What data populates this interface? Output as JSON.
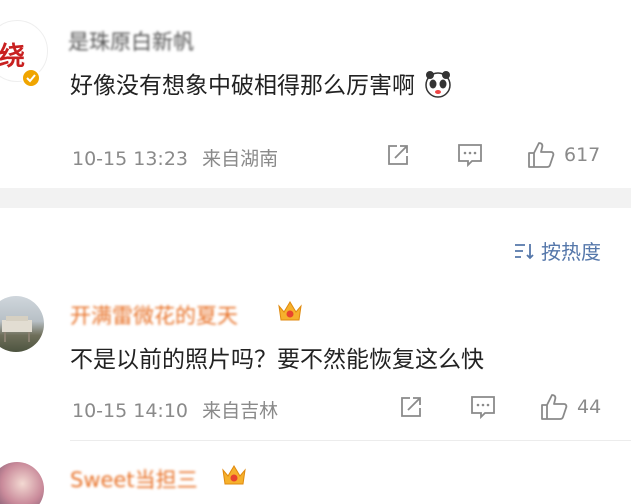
{
  "comments": [
    {
      "username": "是珠原白新帆",
      "avatar_text": "绕",
      "text": "好像没有想象中破相得那么厉害啊",
      "date": "10-15 13:23",
      "location": "来自湖南",
      "likes": "617"
    },
    {
      "username": "开满雷微花的夏天",
      "text": "不是以前的照片吗？要不然能恢复这么快",
      "date": "10-15 14:10",
      "location": "来自吉林",
      "likes": "44"
    },
    {
      "username": "Sweet当担三"
    }
  ],
  "sort_label": "按热度",
  "colors": {
    "username": "#e8732a",
    "sort": "#5577aa",
    "meta": "#8a8a8a",
    "verified": "#f0a500"
  },
  "icons": [
    "share-icon",
    "comment-icon",
    "like-icon",
    "sort-icon",
    "verified-badge-icon",
    "crown-badge-icon",
    "panda-emoji-icon"
  ]
}
